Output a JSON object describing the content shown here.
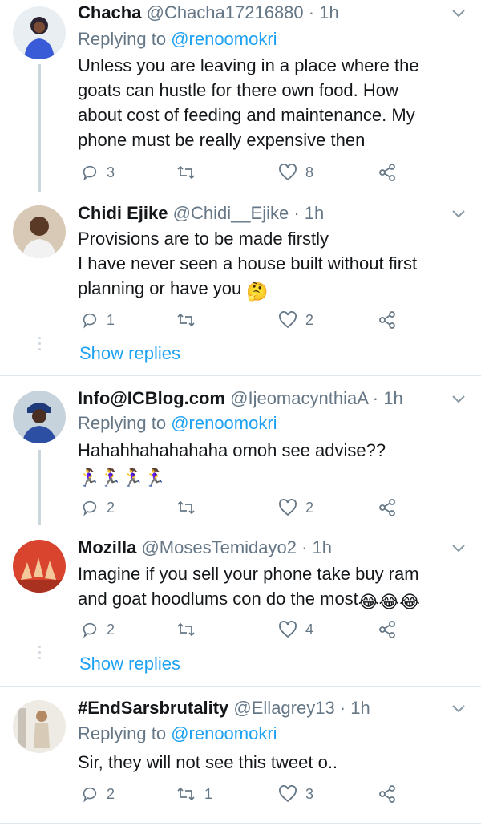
{
  "tweets": [
    {
      "name": "Chacha",
      "handle": "@Chacha17216880 · 1h",
      "reply_prefix": "Replying to ",
      "reply_to": "@renoomokri",
      "lines": [
        "Unless you are leaving in a place where the",
        "goats can hustle for there own food. How",
        "about cost of feeding and maintenance. My",
        "phone must be really expensive then"
      ],
      "replies": "3",
      "retweets": "",
      "likes": "8"
    },
    {
      "name": "Chidi Ejike",
      "handle": "@Chidi__Ejike · 1h",
      "lines": [
        "Provisions are to be made firstly",
        "I have never seen a house built without first",
        "planning or have you"
      ],
      "emoji_end": "🤔",
      "replies": "1",
      "retweets": "",
      "likes": "2",
      "show_replies": "Show replies"
    },
    {
      "name": "Info@ICBlog.com",
      "handle": "@IjeomacynthiaA · 1h",
      "reply_prefix": "Replying to ",
      "reply_to": "@renoomokri",
      "lines": [
        "Hahahhahahahaha omoh see advise??"
      ],
      "emoji_run": "🏃‍♀️🏃‍♀️🏃‍♀️🏃‍♀️",
      "replies": "2",
      "retweets": "",
      "likes": "2"
    },
    {
      "name": "Mozilla",
      "handle": "@MosesTemidayo2 · 1h",
      "lines": [
        "Imagine if you sell your phone take buy ram",
        "and goat hoodlums con do the most"
      ],
      "emoji_end": "😂😂😂",
      "replies": "2",
      "retweets": "",
      "likes": "4",
      "show_replies": "Show replies"
    },
    {
      "name": "#EndSarsbrutality",
      "handle": "@Ellagrey13 · 1h",
      "reply_prefix": "Replying to ",
      "reply_to": "@renoomokri",
      "lines": [
        "Sir, they will not see this tweet o.."
      ],
      "replies": "2",
      "retweets": "1",
      "likes": "3"
    }
  ],
  "icons": {
    "reply": "reply-icon",
    "retweet": "retweet-icon",
    "like": "heart-icon",
    "share": "share-icon",
    "menu": "chevron-down-icon"
  },
  "colors": {
    "text": "#14171a",
    "muted": "#657786",
    "link": "#1da1f2",
    "line": "#ccd6dd"
  }
}
